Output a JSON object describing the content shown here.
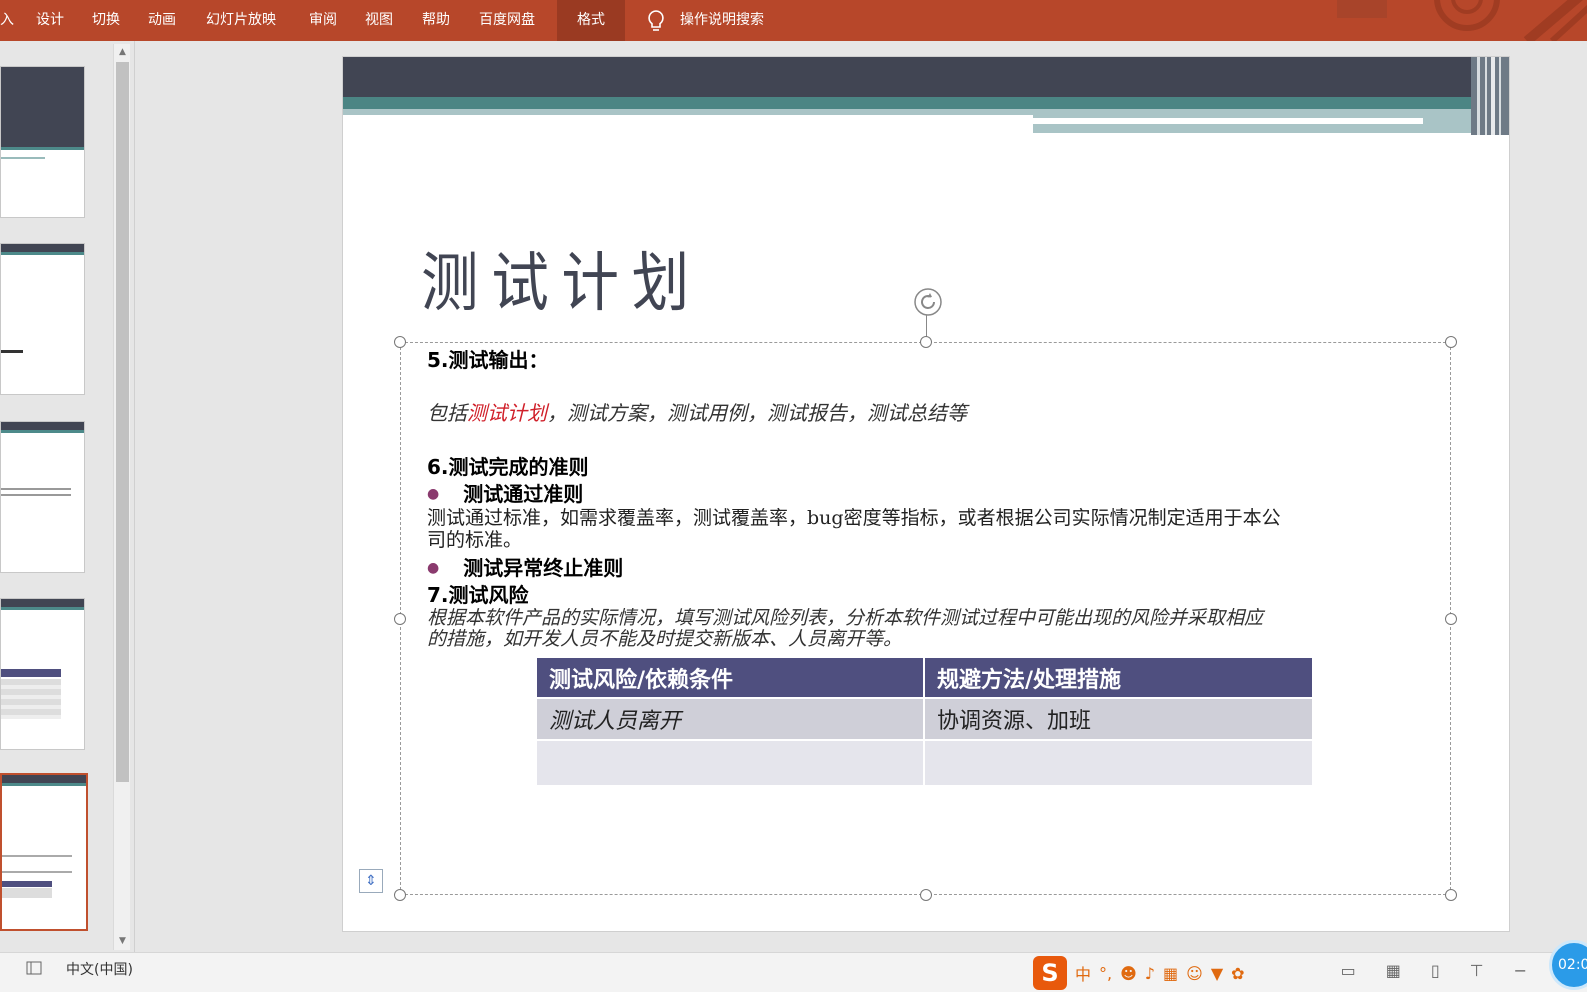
{
  "ribbon": {
    "tabs": [
      "入",
      "设计",
      "切换",
      "动画",
      "幻灯片放映",
      "审阅",
      "视图",
      "帮助",
      "百度网盘",
      "格式"
    ],
    "active_tab": "格式",
    "tell_me": "操作说明搜索"
  },
  "slide": {
    "title": "测试计划",
    "section5": {
      "heading": "5.测试输出：",
      "prefix": "包括",
      "highlight": "测试计划",
      "suffix": "，测试方案，测试用例，测试报告，测试总结等"
    },
    "section6": {
      "heading": "6.测试完成的准则",
      "pass_title": "测试通过准则",
      "pass_text_line1": "测试通过标准，如需求覆盖率，测试覆盖率，bug密度等指标，或者根据公司实际情况制定适用于本公",
      "pass_text_line2": "司的标准。",
      "abort_title": "测试异常终止准则"
    },
    "section7": {
      "heading": "7.测试风险",
      "text_line1": "根据本软件产品的实际情况，填写测试风险列表，分析本软件测试过程中可能出现的风险并采取相应",
      "text_line2": "的措施，如开发人员不能及时提交新版本、人员离开等。"
    },
    "risk_table": {
      "headers": [
        "测试风险/依赖条件",
        "规避方法/处理措施"
      ],
      "rows": [
        [
          "测试人员离开",
          "协调资源、加班"
        ],
        [
          "",
          ""
        ]
      ]
    }
  },
  "status": {
    "language": "中文(中国)",
    "ime_mode": "中",
    "timer": "02:0"
  },
  "colors": {
    "ribbon": "#b7472a",
    "slide_header": "#414553",
    "teal": "#4b8584",
    "table_header": "#4f4f7f",
    "highlight_red": "#d0202a"
  }
}
